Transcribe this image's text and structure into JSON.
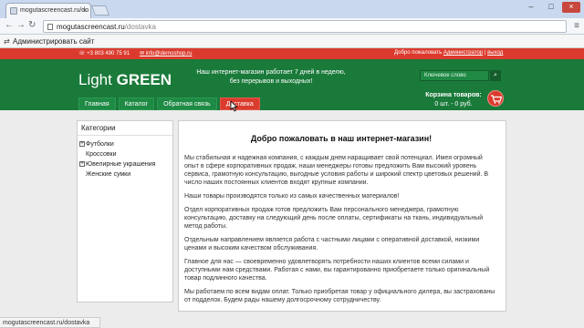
{
  "browser": {
    "tab_title": "mogutascreencast.ru/do",
    "url_host": "mogutascreencast.ru",
    "url_path": "/dostavka",
    "status_url": "mogutascreencast.ru/dostavka"
  },
  "adminbar": {
    "label": "Администрировать сайт"
  },
  "topbar": {
    "phone": "+3 803 490 75 91",
    "email": "info@demoshop.ru",
    "welcome_prefix": "Добро пожаловать",
    "welcome_user": "Администратор",
    "logout": "выход"
  },
  "header": {
    "logo_light": "Light",
    "logo_bold": "GREEN",
    "tagline": "Наш интернет-магазин работает 7 дней в неделю, без перерывов и выходных!",
    "search_placeholder": "Ключевое слово",
    "cart_title": "Корзина товаров:",
    "cart_summary": "0 шт. - 0 руб."
  },
  "menu": [
    "Главная",
    "Каталог",
    "Обратная связь",
    "Доставка"
  ],
  "sidebar": {
    "title": "Категории",
    "items": [
      "Футболки",
      "Кроссовки",
      "Ювелирные украшения",
      "Женские сумки"
    ]
  },
  "content": {
    "title": "Добро пожаловать в наш интернет-магазин!",
    "p1": "Мы стабильная и надежная компания, с каждым днем наращивает свой потенциал. Имея огромный опыт в сфере корпоративных продаж, наши менеджеры готовы предложить Вам высокий уровень сервиса, грамотную консультацию, выгодные условия работы и широкий спектр цветовых решений. В число наших постоянных клиентов входят крупные компании.",
    "p2": "Наши товары производятся только из самых качественных материалов!",
    "p3": "Отдел корпоративных продаж готов предложить Вам персонального менеджера, грамотную консультацию, доставку на следующий день после оплаты, сертификаты на ткань, индивидуальный метод работы.",
    "p4": "Отдельным направлением является работа с частными лицами с оперативной доставкой, низкими ценами и высоким качеством обслуживания.",
    "p5": "Главное для нас — своевременно удовлетворять потребности наших клиентов всеми силами и доступными нам средствами. Работая с нами, вы гарантированно приобретаете только оригинальный товар подлинного качества.",
    "p6": "Мы работаем по всем видам оплат. Только приобретая товар у официального дилера, вы застрахованы от подделок. Будем рады нашему долгосрочному сотрудничеству."
  },
  "colors": {
    "brand_green": "#1a7a3a",
    "brand_red": "#db3b2e"
  }
}
